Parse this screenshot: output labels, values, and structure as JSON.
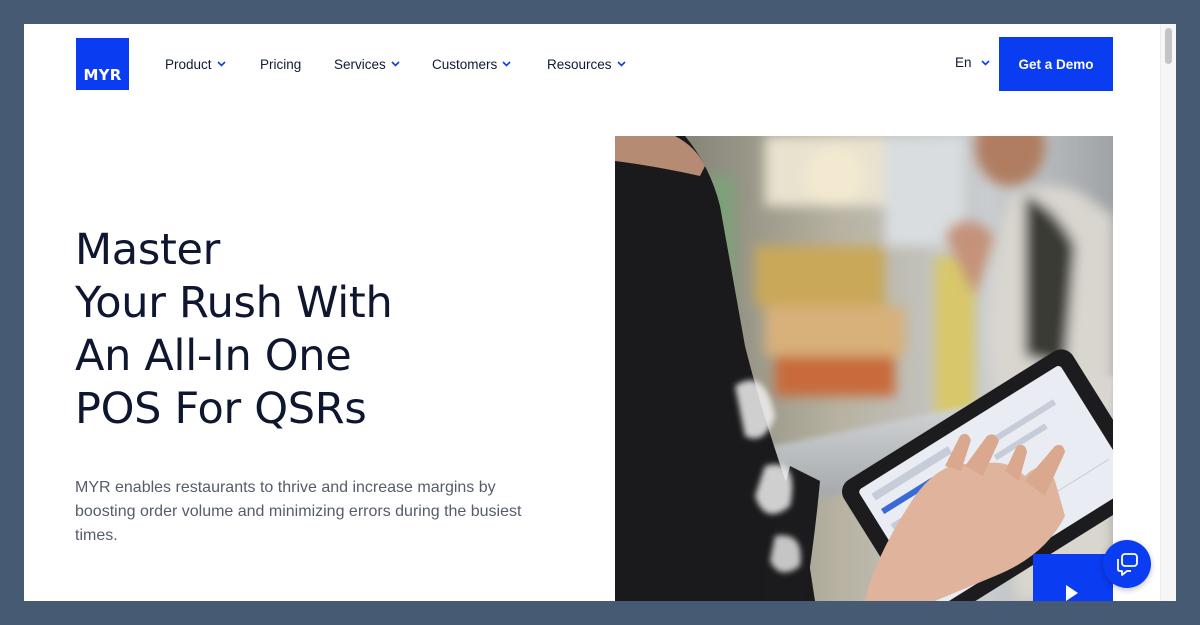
{
  "brand": {
    "logo_text": "MYR",
    "accent_color": "#0a3cf2"
  },
  "nav": {
    "items": [
      {
        "label": "Product",
        "has_dropdown": true
      },
      {
        "label": "Pricing",
        "has_dropdown": false
      },
      {
        "label": "Services",
        "has_dropdown": true
      },
      {
        "label": "Customers",
        "has_dropdown": true
      },
      {
        "label": "Resources",
        "has_dropdown": true
      }
    ],
    "language": "En",
    "cta_label": "Get a Demo"
  },
  "hero": {
    "headline_lines": [
      "Master",
      "Your Rush With",
      "An All-In One",
      "POS For QSRs"
    ],
    "subtext": "MYR enables restaurants to thrive and increase margins by boosting order volume and minimizing errors during the busiest times.",
    "media_icon": "play-icon"
  },
  "widgets": {
    "chat_icon": "chat-icon"
  }
}
